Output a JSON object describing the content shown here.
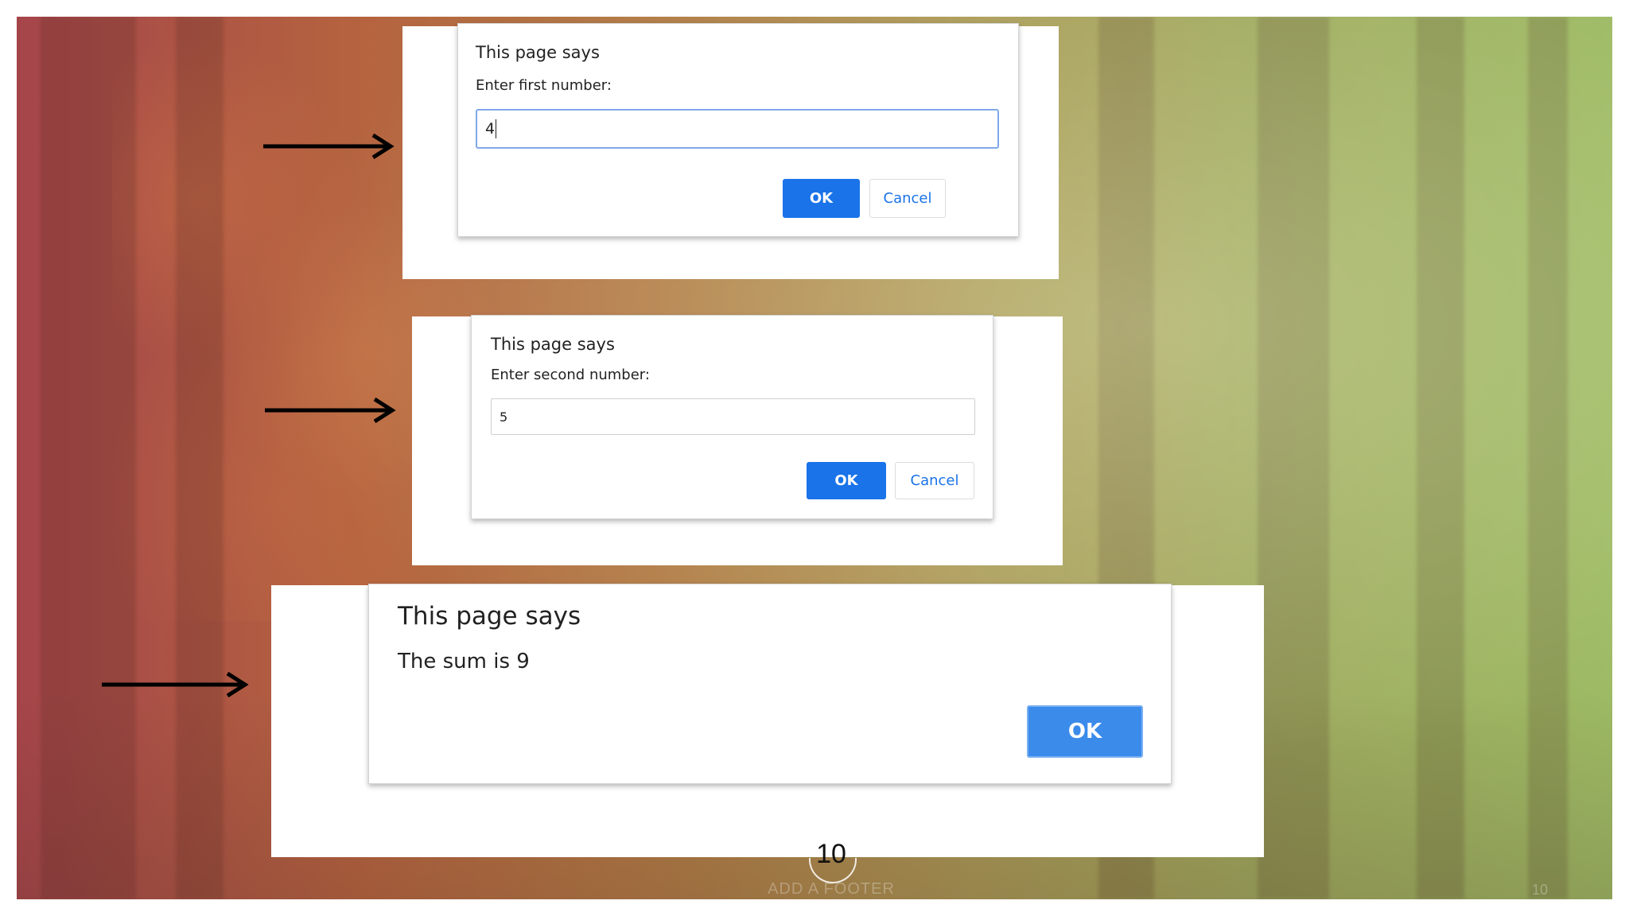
{
  "dialog1": {
    "title": "This page says",
    "message": "Enter first number:",
    "input_value": "4",
    "ok_label": "OK",
    "cancel_label": "Cancel"
  },
  "dialog2": {
    "title": "This page says",
    "message": "Enter second number:",
    "input_value": "5",
    "ok_label": "OK",
    "cancel_label": "Cancel"
  },
  "dialog3": {
    "title": "This page says",
    "message": "The sum is 9",
    "ok_label": "OK"
  },
  "slide": {
    "page_number": "10",
    "footer_text": "ADD A FOOTER",
    "corner_number": "10"
  },
  "colors": {
    "primary_button": "#1a73e8",
    "result_button": "#3b8beb",
    "background_left": "#a5454a",
    "background_right": "#9dba64"
  },
  "icons": [
    "right-arrow-icon",
    "right-arrow-icon",
    "right-arrow-icon"
  ]
}
